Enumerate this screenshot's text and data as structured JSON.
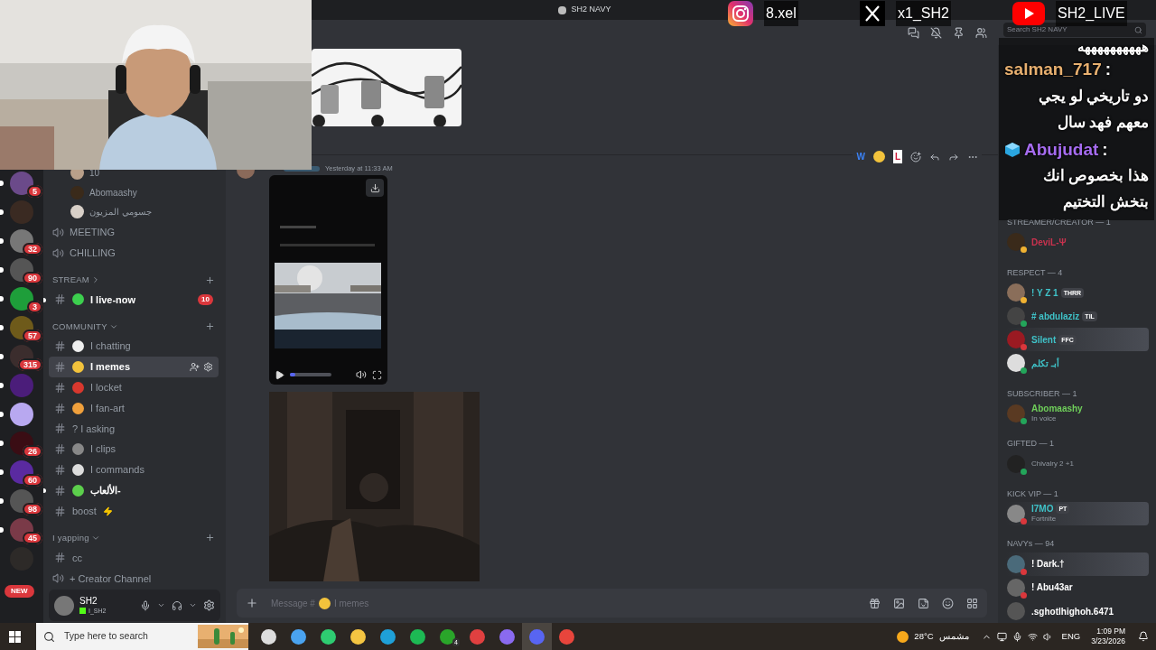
{
  "window": {
    "title": "SH2 NAVY"
  },
  "socials": [
    {
      "kind": "instagram",
      "handle": "8.xel"
    },
    {
      "kind": "x",
      "handle": "x1_SH2"
    },
    {
      "kind": "youtube",
      "handle": "SH2_LIVE"
    }
  ],
  "servers": [
    {
      "badge": "5",
      "unread": true
    },
    {
      "unread": true
    },
    {
      "badge": "32",
      "unread": true
    },
    {
      "badge": "90",
      "unread": true
    },
    {
      "badge": "3",
      "unread": true
    },
    {
      "badge": "57",
      "unread": true
    },
    {
      "badge": "315",
      "unread": true
    },
    {
      "unread": true
    },
    {
      "unread": true
    },
    {
      "badge": "26",
      "unread": true
    },
    {
      "badge": "60",
      "unread": true
    },
    {
      "badge": "98",
      "unread": true
    },
    {
      "badge": "45",
      "unread": true
    },
    {
      "unread": false
    }
  ],
  "new_badge": "NEW",
  "channels": [
    {
      "kind": "member",
      "name": "10"
    },
    {
      "kind": "member",
      "name": "Abomaashy"
    },
    {
      "kind": "member",
      "name": "جسومي المزيون"
    },
    {
      "kind": "voice",
      "name": "MEETING"
    },
    {
      "kind": "voice",
      "name": "CHILLING"
    },
    {
      "kind": "category",
      "name": "STREAM",
      "expanded": false
    },
    {
      "kind": "text",
      "name": "I live-now",
      "emoji": true,
      "badge": "10",
      "unread": true,
      "selected": false
    },
    {
      "kind": "category",
      "name": "COMMUNITY",
      "expanded": true
    },
    {
      "kind": "text",
      "name": "I chatting",
      "emoji": true,
      "unread": false,
      "selected": false
    },
    {
      "kind": "text",
      "name": "I memes",
      "emoji": true,
      "unread": false,
      "selected": true
    },
    {
      "kind": "text",
      "name": "I locket",
      "emoji": true,
      "unread": false,
      "selected": false
    },
    {
      "kind": "text",
      "name": "I fan-art",
      "emoji": true,
      "unread": false,
      "selected": false
    },
    {
      "kind": "text",
      "name": "? I asking",
      "emoji": false,
      "unread": false,
      "selected": false
    },
    {
      "kind": "text",
      "name": "I clips",
      "emoji": true,
      "unread": false,
      "selected": false
    },
    {
      "kind": "text",
      "name": "I commands",
      "emoji": true,
      "unread": false,
      "selected": false
    },
    {
      "kind": "text",
      "name": "الألعاب-",
      "emoji": true,
      "unread": true,
      "selected": false
    },
    {
      "kind": "text",
      "name": "boost",
      "emoji": true,
      "unread": false,
      "selected": false
    },
    {
      "kind": "category",
      "name": "I yapping",
      "expanded": true
    },
    {
      "kind": "text",
      "name": "cc",
      "emoji": false,
      "unread": false,
      "selected": false
    },
    {
      "kind": "voice",
      "name": "+ Creator Channel"
    }
  ],
  "user": {
    "name": "SH2",
    "tag": "I_SH2"
  },
  "search": {
    "placeholder": "Search SH2 NAVY"
  },
  "message": {
    "timestamp": "Yesterday at 11:33 AM",
    "quick_reactions": [
      {
        "kind": "letter",
        "text": "W"
      },
      {
        "kind": "emoji"
      },
      {
        "kind": "letter",
        "text": "L"
      }
    ],
    "video": {
      "level": 0.12
    }
  },
  "composer": {
    "placeholder": "Message #",
    "placeholder_channel": "I memes"
  },
  "chat_overlay": {
    "partial": "ههههههههههه",
    "messages": [
      {
        "user": "salman_717",
        "color": "#e8b070",
        "separator": ":",
        "text": "دو تاريخي لو يجي معهم فهد سال"
      },
      {
        "user": "Abujudat",
        "color": "#a66cf0",
        "icon": true,
        "separator": ":",
        "text": "هذا بخصوص انك بتخش التختيم"
      }
    ]
  },
  "members": [
    {
      "kind": "header",
      "name": "STREAMER/CREATOR — 1"
    },
    {
      "kind": "member",
      "name": "DeviL-Ψ",
      "color": "#c8324e",
      "status_dot": {
        "color": "#f0b232"
      },
      "banner": false
    },
    {
      "kind": "header",
      "name": "RESPECT — 4"
    },
    {
      "kind": "member",
      "name": "! Y Z 1",
      "color": "#3fc2c8",
      "tag": "THRR",
      "status_dot": {
        "color": "#f0b232"
      },
      "banner": false
    },
    {
      "kind": "member",
      "name": "# abdulaziz",
      "color": "#3fc2c8",
      "tag": "TIL",
      "status_dot": {
        "color": "#23a55a"
      },
      "banner": false
    },
    {
      "kind": "member",
      "name": "Silent",
      "color": "#3fc2c8",
      "tag": "FFC",
      "status_dot": {
        "color": "#da373c"
      },
      "banner": true
    },
    {
      "kind": "member",
      "name": "أبـ تكلم",
      "color": "#3fc2c8",
      "status_dot": {
        "color": "#23a55a"
      },
      "banner": false
    },
    {
      "kind": "header",
      "name": "SUBSCRIBER — 1"
    },
    {
      "kind": "member",
      "name": "Abomaashy",
      "color": "#6fce5a",
      "activity": "In voice",
      "status_dot": {
        "color": "#23a55a"
      },
      "banner": false
    },
    {
      "kind": "header",
      "name": "GIFTED — 1"
    },
    {
      "kind": "member",
      "activity": "Chivalry 2 +1",
      "status_dot": {
        "color": "#23a55a"
      },
      "banner": false
    },
    {
      "kind": "header",
      "name": "KICK VIP — 1"
    },
    {
      "kind": "member",
      "name": "I7MO",
      "color": "#3fc2c8",
      "tag": "PT",
      "activity": "Fortnite",
      "status_dot": {
        "color": "#da373c"
      },
      "banner": true
    },
    {
      "kind": "header",
      "name": "NAVYs — 94"
    },
    {
      "kind": "member",
      "name": "! Dark.†",
      "color": "#ffffff",
      "status_dot": {
        "color": "#da373c"
      },
      "banner": true
    },
    {
      "kind": "member",
      "name": "! Abu43ar",
      "color": "#ffffff",
      "status_dot": {
        "color": "#da373c"
      },
      "banner": false
    },
    {
      "kind": "member",
      "name": ".sghotlhighoh.6471",
      "color": "#ffffff",
      "banner": false
    }
  ],
  "taskbar": {
    "search_placeholder": "Type here to search",
    "apps": [
      {
        "kind": "taskview",
        "selected": false
      },
      {
        "kind": "copilot",
        "selected": false
      },
      {
        "kind": "play",
        "selected": false
      },
      {
        "kind": "folder",
        "selected": false
      },
      {
        "kind": "edge",
        "selected": false
      },
      {
        "kind": "spotify",
        "selected": false
      },
      {
        "kind": "xbox",
        "badge": "4",
        "selected": false
      },
      {
        "kind": "recorder",
        "selected": false
      },
      {
        "kind": "chat",
        "selected": false
      },
      {
        "kind": "discord",
        "selected": true
      },
      {
        "kind": "chrome",
        "selected": false
      }
    ],
    "temperature": "28°C",
    "condition": "مشمس",
    "language": "ENG",
    "time": "1:09 PM",
    "date": "3/23/2026"
  }
}
